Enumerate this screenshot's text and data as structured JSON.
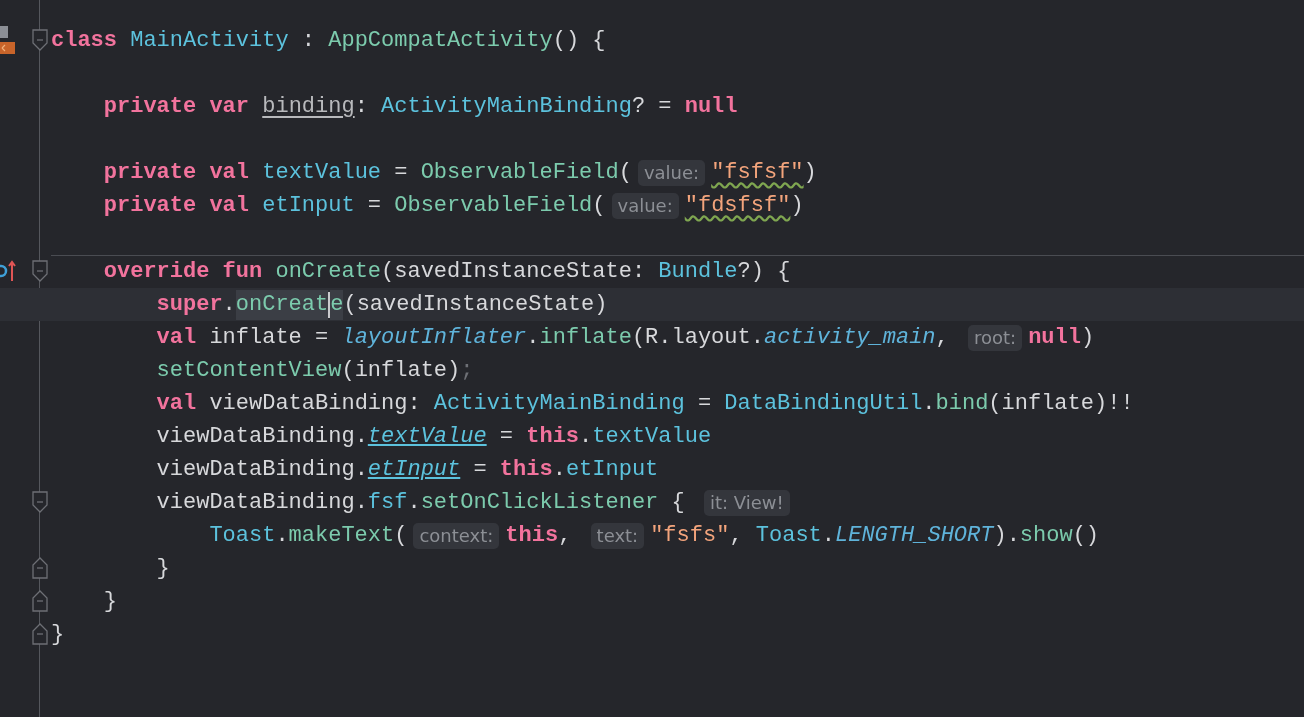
{
  "editor": {
    "lines": [
      {
        "kind": "code",
        "gutter": {
          "kind": "class-open"
        },
        "tokens": [
          {
            "kind": "kw",
            "text": "class "
          },
          {
            "kind": "decl",
            "text": "MainActivity"
          },
          {
            "kind": "plain",
            "text": " : "
          },
          {
            "kind": "call",
            "text": "AppCompatActivity"
          },
          {
            "kind": "plain",
            "text": "() {"
          }
        ],
        "children": [
          {
            "kind": "blank"
          },
          {
            "kind": "code",
            "tokens": [
              {
                "kind": "kw",
                "text": "private var "
              },
              {
                "kind": "unused",
                "text": "binding"
              },
              {
                "kind": "plain",
                "text": ": "
              },
              {
                "kind": "type",
                "text": "ActivityMainBinding"
              },
              {
                "kind": "plain",
                "text": "? = "
              },
              {
                "kind": "kw",
                "text": "null"
              }
            ]
          },
          {
            "kind": "blank"
          },
          {
            "kind": "code",
            "tokens": [
              {
                "kind": "kw",
                "text": "private val "
              },
              {
                "kind": "decl",
                "text": "textValue"
              },
              {
                "kind": "plain",
                "text": " = "
              },
              {
                "kind": "call",
                "text": "ObservableField"
              },
              {
                "kind": "plain",
                "text": "("
              },
              {
                "kind": "hint",
                "text": "value:"
              },
              {
                "kind": "typo",
                "text": "\"fsfsf\""
              },
              {
                "kind": "plain",
                "text": ")"
              }
            ]
          },
          {
            "kind": "code",
            "tokens": [
              {
                "kind": "kw",
                "text": "private val "
              },
              {
                "kind": "decl",
                "text": "etInput"
              },
              {
                "kind": "plain",
                "text": " = "
              },
              {
                "kind": "call",
                "text": "ObservableField"
              },
              {
                "kind": "plain",
                "text": "("
              },
              {
                "kind": "hint",
                "text": "value:"
              },
              {
                "kind": "typo",
                "text": "\"fdsfsf\""
              },
              {
                "kind": "plain",
                "text": ")"
              }
            ]
          },
          {
            "kind": "blank"
          },
          {
            "kind": "method",
            "gutter": {
              "kind": "override-open"
            },
            "tokens": [
              {
                "kind": "kw",
                "text": "override fun "
              },
              {
                "kind": "call",
                "text": "onCreate"
              },
              {
                "kind": "plain",
                "text": "(savedInstanceState: "
              },
              {
                "kind": "type",
                "text": "Bundle"
              },
              {
                "kind": "plain",
                "text": "?) {"
              }
            ],
            "children": [
              {
                "kind": "current",
                "tokens": [
                  {
                    "kind": "kw",
                    "text": "super"
                  },
                  {
                    "kind": "plain",
                    "text": "."
                  },
                  {
                    "kind": "highlight",
                    "text": "onCreat"
                  },
                  {
                    "kind": "caret"
                  },
                  {
                    "kind": "highlight",
                    "text": "e"
                  },
                  {
                    "kind": "plain",
                    "text": "(savedInstanceState)"
                  }
                ]
              },
              {
                "kind": "code",
                "tokens": [
                  {
                    "kind": "kw",
                    "text": "val "
                  },
                  {
                    "kind": "plain",
                    "text": "inflate = "
                  },
                  {
                    "kind": "italic",
                    "text": "layoutInflater"
                  },
                  {
                    "kind": "plain",
                    "text": "."
                  },
                  {
                    "kind": "call",
                    "text": "inflate"
                  },
                  {
                    "kind": "plain",
                    "text": "(R.layout."
                  },
                  {
                    "kind": "italic",
                    "text": "activity_main"
                  },
                  {
                    "kind": "plain",
                    "text": ", "
                  },
                  {
                    "kind": "hint",
                    "text": "root:"
                  },
                  {
                    "kind": "kw",
                    "text": "null"
                  },
                  {
                    "kind": "plain",
                    "text": ")"
                  }
                ]
              },
              {
                "kind": "code",
                "tokens": [
                  {
                    "kind": "call",
                    "text": "setContentView"
                  },
                  {
                    "kind": "plain",
                    "text": "(inflate)"
                  },
                  {
                    "kind": "muted",
                    "text": ";"
                  }
                ]
              },
              {
                "kind": "code",
                "tokens": [
                  {
                    "kind": "kw",
                    "text": "val "
                  },
                  {
                    "kind": "plain",
                    "text": "viewDataBinding: "
                  },
                  {
                    "kind": "type",
                    "text": "ActivityMainBinding"
                  },
                  {
                    "kind": "plain",
                    "text": " = "
                  },
                  {
                    "kind": "type",
                    "text": "DataBindingUtil"
                  },
                  {
                    "kind": "plain",
                    "text": "."
                  },
                  {
                    "kind": "call",
                    "text": "bind"
                  },
                  {
                    "kind": "plain",
                    "text": "(inflate)!!"
                  }
                ]
              },
              {
                "kind": "code",
                "tokens": [
                  {
                    "kind": "plain",
                    "text": "viewDataBinding."
                  },
                  {
                    "kind": "link",
                    "text": "textValue"
                  },
                  {
                    "kind": "plain",
                    "text": " = "
                  },
                  {
                    "kind": "kw",
                    "text": "this"
                  },
                  {
                    "kind": "plain",
                    "text": "."
                  },
                  {
                    "kind": "decl",
                    "text": "textValue"
                  }
                ]
              },
              {
                "kind": "code",
                "tokens": [
                  {
                    "kind": "plain",
                    "text": "viewDataBinding."
                  },
                  {
                    "kind": "link",
                    "text": "etInput"
                  },
                  {
                    "kind": "plain",
                    "text": " = "
                  },
                  {
                    "kind": "kw",
                    "text": "this"
                  },
                  {
                    "kind": "plain",
                    "text": "."
                  },
                  {
                    "kind": "decl",
                    "text": "etInput"
                  }
                ]
              },
              {
                "kind": "code",
                "gutter": {
                  "kind": "fold-open"
                },
                "tokens": [
                  {
                    "kind": "plain",
                    "text": "viewDataBinding."
                  },
                  {
                    "kind": "decl",
                    "text": "fsf"
                  },
                  {
                    "kind": "plain",
                    "text": "."
                  },
                  {
                    "kind": "call",
                    "text": "setOnClickListener"
                  },
                  {
                    "kind": "plain",
                    "text": " { "
                  },
                  {
                    "kind": "hint",
                    "text": "it: View!"
                  }
                ],
                "children": [
                  {
                    "kind": "code",
                    "tokens": [
                      {
                        "kind": "type",
                        "text": "Toast"
                      },
                      {
                        "kind": "plain",
                        "text": "."
                      },
                      {
                        "kind": "call",
                        "text": "makeText"
                      },
                      {
                        "kind": "plain",
                        "text": "("
                      },
                      {
                        "kind": "hint",
                        "text": "context:"
                      },
                      {
                        "kind": "kw",
                        "text": "this"
                      },
                      {
                        "kind": "plain",
                        "text": ", "
                      },
                      {
                        "kind": "hint",
                        "text": "text:"
                      },
                      {
                        "kind": "string",
                        "text": "\"fsfs\""
                      },
                      {
                        "kind": "plain",
                        "text": ", "
                      },
                      {
                        "kind": "type",
                        "text": "Toast"
                      },
                      {
                        "kind": "plain",
                        "text": "."
                      },
                      {
                        "kind": "static",
                        "text": "LENGTH_SHORT"
                      },
                      {
                        "kind": "plain",
                        "text": ")."
                      },
                      {
                        "kind": "call",
                        "text": "show"
                      },
                      {
                        "kind": "plain",
                        "text": "()"
                      }
                    ]
                  }
                ]
              },
              {
                "kind": "code",
                "gutter": {
                  "kind": "fold-close"
                },
                "tokens": [
                  {
                    "kind": "plain",
                    "text": "}"
                  }
                ]
              }
            ]
          },
          {
            "kind": "code",
            "gutter": {
              "kind": "fold-close"
            },
            "tokens": [
              {
                "kind": "plain",
                "text": "}"
              }
            ]
          }
        ]
      },
      {
        "kind": "code",
        "gutter": {
          "kind": "fold-close"
        },
        "tokens": [
          {
            "kind": "plain",
            "text": "}"
          }
        ]
      }
    ]
  }
}
